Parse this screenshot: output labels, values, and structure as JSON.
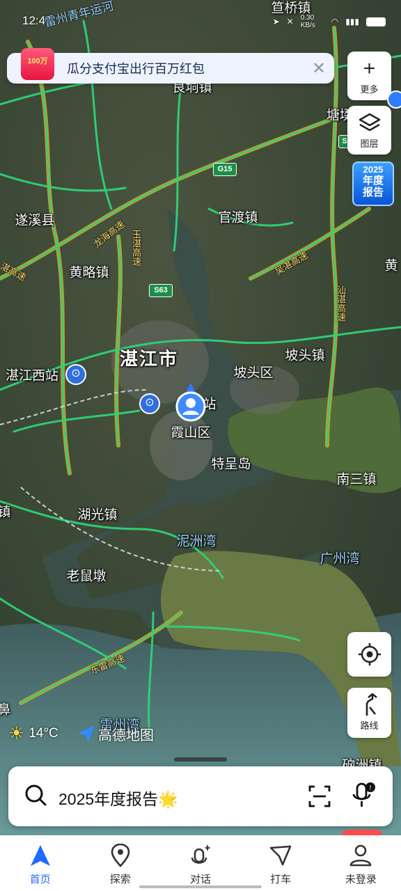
{
  "status_bar": {
    "time": "12:4",
    "network_speed": "0.30 KB/s"
  },
  "promo": {
    "badge": "100万",
    "text": "瓜分支付宝出行百万红包",
    "close_icon": "close-icon"
  },
  "tools": {
    "more_label": "更多",
    "layers_label": "图层",
    "annual_report_year": "2025",
    "annual_report_text1": "年度",
    "annual_report_text2": "报告",
    "locate_icon": "crosshair-icon",
    "route_label": "路线"
  },
  "map": {
    "places": {
      "guanqiao": "笪桥镇",
      "liangdong": "良垌镇",
      "tangchun": "塘㙍",
      "suixi": "遂溪县",
      "guandu": "官渡镇",
      "huanglue": "黄略镇",
      "huangpo": "黄",
      "zhanjiang": "湛江市",
      "potou_town": "坡头镇",
      "zhanjiang_west": "湛江西站",
      "potou_district": "坡头区",
      "zhanjiang_station": "湛江站",
      "xiashan": "霞山区",
      "techeng": "特呈岛",
      "nansan": "南三镇",
      "huguang": "湖光镇",
      "nizhou_bay": "泥洲湾",
      "guangzhou_bay": "广州湾",
      "laoshudun": "老鼠墩",
      "leizhou_bay": "雷州湾",
      "left_edge": "镇",
      "left_edge2": "鼻",
      "bottom_right": "硇洲镇"
    },
    "roads": {
      "leizhou_youth": "雷州青年运河",
      "longhai": "龙海高速",
      "yuzhan": "玉湛高速",
      "suixi_hw": "汕湛高速",
      "wuzhan": "吴湛高速",
      "shanzhan": "汕湛高速",
      "donglei": "东雷高速",
      "left_hw": "湛高速"
    },
    "shields": {
      "g15": "G15",
      "s63": "S63",
      "s_right": "S"
    }
  },
  "weather": {
    "icon": "sun-icon",
    "temperature": "14°C"
  },
  "logo": {
    "text": "高德地图"
  },
  "search": {
    "text": "2025年度报告",
    "emoji": "🌟",
    "scan_icon": "scan-icon",
    "mic_icon": "mic-icon"
  },
  "nav": {
    "items": [
      {
        "label": "首页",
        "icon": "navigation-arrow-icon"
      },
      {
        "label": "探索",
        "icon": "location-pin-icon"
      },
      {
        "label": "对话",
        "icon": "microphone-sparkle-icon"
      },
      {
        "label": "打车",
        "icon": "taxi-icon"
      },
      {
        "label": "未登录",
        "icon": "user-icon"
      }
    ]
  },
  "colors": {
    "accent": "#1e6bff",
    "road_green": "#2fd27a",
    "road_orange": "#e79a25"
  }
}
